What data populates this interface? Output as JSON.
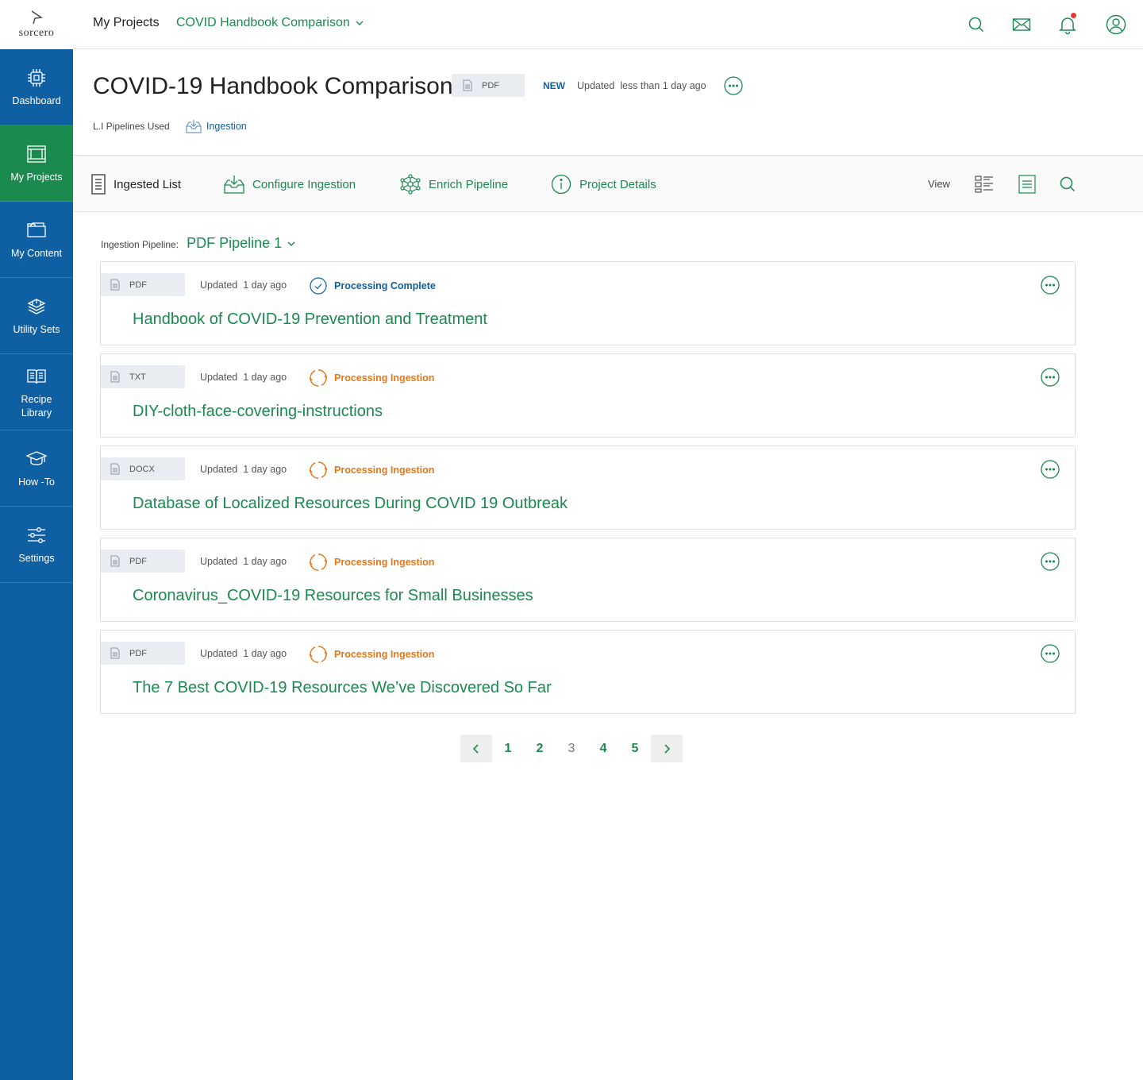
{
  "brand": {
    "logo_text": "sorcero"
  },
  "sidebar": {
    "items": [
      {
        "label": "Dashboard",
        "icon": "chip-icon"
      },
      {
        "label": "My Projects",
        "icon": "projects-icon",
        "active": true
      },
      {
        "label": "My Content",
        "icon": "folder-icon"
      },
      {
        "label": "Utility Sets",
        "icon": "stack-icon"
      },
      {
        "label": "Recipe\nLibrary",
        "icon": "book-icon"
      },
      {
        "label": "How -To",
        "icon": "graduation-cap-icon"
      },
      {
        "label": "Settings",
        "icon": "sliders-icon"
      }
    ]
  },
  "header": {
    "breadcrumb_root": "My Projects",
    "breadcrumb_project": "COVID Handbook Comparison",
    "icons": [
      "search-icon",
      "mail-icon",
      "bell-icon",
      "user-icon"
    ]
  },
  "project": {
    "title": "COVID-19 Handbook Comparison",
    "type": "PDF",
    "badge": "NEW",
    "updated": "Updated  less than 1 day ago",
    "pipelines_label": "L.I Pipelines Used",
    "pipeline_link": "Ingestion"
  },
  "toolbar": {
    "ingested_list": "Ingested List",
    "configure": "Configure Ingestion",
    "enrich": "Enrich Pipeline",
    "details": "Project Details",
    "view_label": "View"
  },
  "content": {
    "pipeline_label": "Ingestion Pipeline:",
    "pipeline_value": "PDF Pipeline 1",
    "documents": [
      {
        "type": "PDF",
        "updated": "Updated  1 day ago",
        "status": "Processing Complete",
        "status_kind": "complete",
        "title": "Handbook of COVID-19 Prevention and Treatment"
      },
      {
        "type": "TXT",
        "updated": "Updated  1 day ago",
        "status": "Processing Ingestion",
        "status_kind": "processing",
        "title": "DIY-cloth-face-covering-instructions"
      },
      {
        "type": "DOCX",
        "updated": "Updated  1 day ago",
        "status": "Processing Ingestion",
        "status_kind": "processing",
        "title": "Database of Localized Resources During COVID 19 Outbreak"
      },
      {
        "type": "PDF",
        "updated": "Updated  1 day ago",
        "status": "Processing Ingestion",
        "status_kind": "processing",
        "title": "Coronavirus_COVID-19 Resources for Small Businesses"
      },
      {
        "type": "PDF",
        "updated": "Updated  1 day ago",
        "status": "Processing Ingestion",
        "status_kind": "processing",
        "title": "The 7 Best COVID-19 Resources We’ve Discovered So Far"
      }
    ]
  },
  "pagination": {
    "pages": [
      "1",
      "2",
      "3",
      "4",
      "5"
    ],
    "current": "3"
  },
  "colors": {
    "sidebar": "#0f5fa3",
    "active": "#1b8a4f",
    "green": "#1b8a4f",
    "blue": "#0f5fa3",
    "orange": "#e67817"
  }
}
